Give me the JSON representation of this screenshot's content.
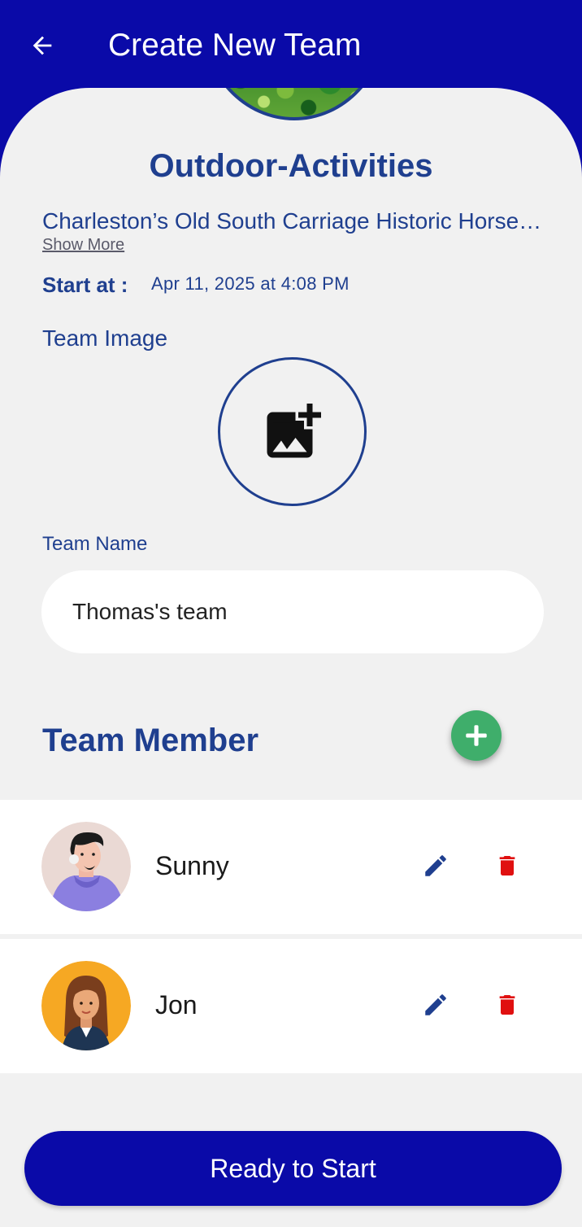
{
  "appbar": {
    "title": "Create New Team",
    "back_icon": "arrow-left-icon",
    "background_color": "#0a0aa8"
  },
  "activity": {
    "title": "Outdoor-Activities",
    "description": "Charleston’s Old South Carriage Historic Horse-Drawn Carriage Tour",
    "show_more": "Show More",
    "start_label": "Start at :",
    "start_value": "Apr 11, 2025 at 4:08 PM"
  },
  "team_image": {
    "label": "Team Image",
    "icon": "add-photo-icon"
  },
  "team_name": {
    "label": "Team Name",
    "value": "Thomas's team"
  },
  "members_section": {
    "title": "Team Member",
    "add_icon": "plus-icon"
  },
  "members": [
    {
      "name": "Sunny",
      "avatar": "man-avatar",
      "edit_icon": "pencil-icon",
      "delete_icon": "trash-icon"
    },
    {
      "name": "Jon",
      "avatar": "woman-avatar",
      "edit_icon": "pencil-icon",
      "delete_icon": "trash-icon"
    }
  ],
  "actions": {
    "ready_label": "Ready to Start"
  },
  "colors": {
    "primary": "#0a0aa8",
    "text_blue": "#1f3f8f",
    "add_green": "#3fae6b",
    "delete_red": "#e01010",
    "background": "#f1f1f1"
  }
}
